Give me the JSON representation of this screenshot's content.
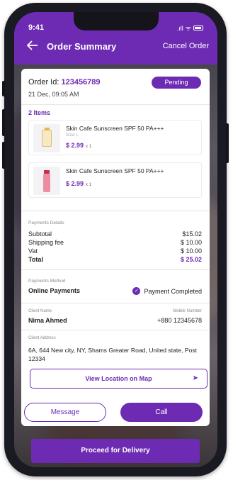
{
  "status_bar": {
    "time": "9:41",
    "signal": ".ıll",
    "wifi": "ᯤ"
  },
  "header": {
    "back_icon": "arrow-left-icon",
    "title": "Order Summary",
    "cancel_label": "Cancel Order"
  },
  "order": {
    "id_label": "Order Id: ",
    "id_value": "123456789",
    "date": "21 Dec, 09:05 AM",
    "status": "Pending"
  },
  "items": {
    "count_label": "2 Items",
    "list": [
      {
        "name": "Skin Cafe Sunscreen SPF 50 PA+++",
        "size": "Size: L",
        "price": "$ 2.99",
        "qty": "x 1"
      },
      {
        "name": "Skin Cafe Sunscreen SPF 50 PA+++",
        "size": "",
        "price": "$ 2.99",
        "qty": "x 1"
      }
    ]
  },
  "payment_details": {
    "label": "Payments Details",
    "rows": [
      {
        "label": "Subtotal",
        "value": "$15.02"
      },
      {
        "label": "Shipping fee",
        "value": "$ 10.00"
      },
      {
        "label": "Vat",
        "value": "$ 10.00"
      },
      {
        "label": "Total",
        "value": "$ 25.02"
      }
    ]
  },
  "payment_method": {
    "label": "Payments Method",
    "value": "Online Payments",
    "status": "Payment Completed"
  },
  "client": {
    "name_label": "Client Name",
    "name": "Nima Ahmed",
    "mobile_label": "Mobile Number",
    "mobile": "+880 12345678"
  },
  "address": {
    "label": "Client Address",
    "value": "6A, 644 New city, NY, Shams Greater Road, United state, Post 12334"
  },
  "actions": {
    "map_label": "View Location on Map",
    "message_label": "Message",
    "call_label": "Call",
    "proceed_label": "Proceed for Delivery"
  },
  "colors": {
    "accent": "#6d2bb3",
    "frame": "#1a1a22"
  }
}
